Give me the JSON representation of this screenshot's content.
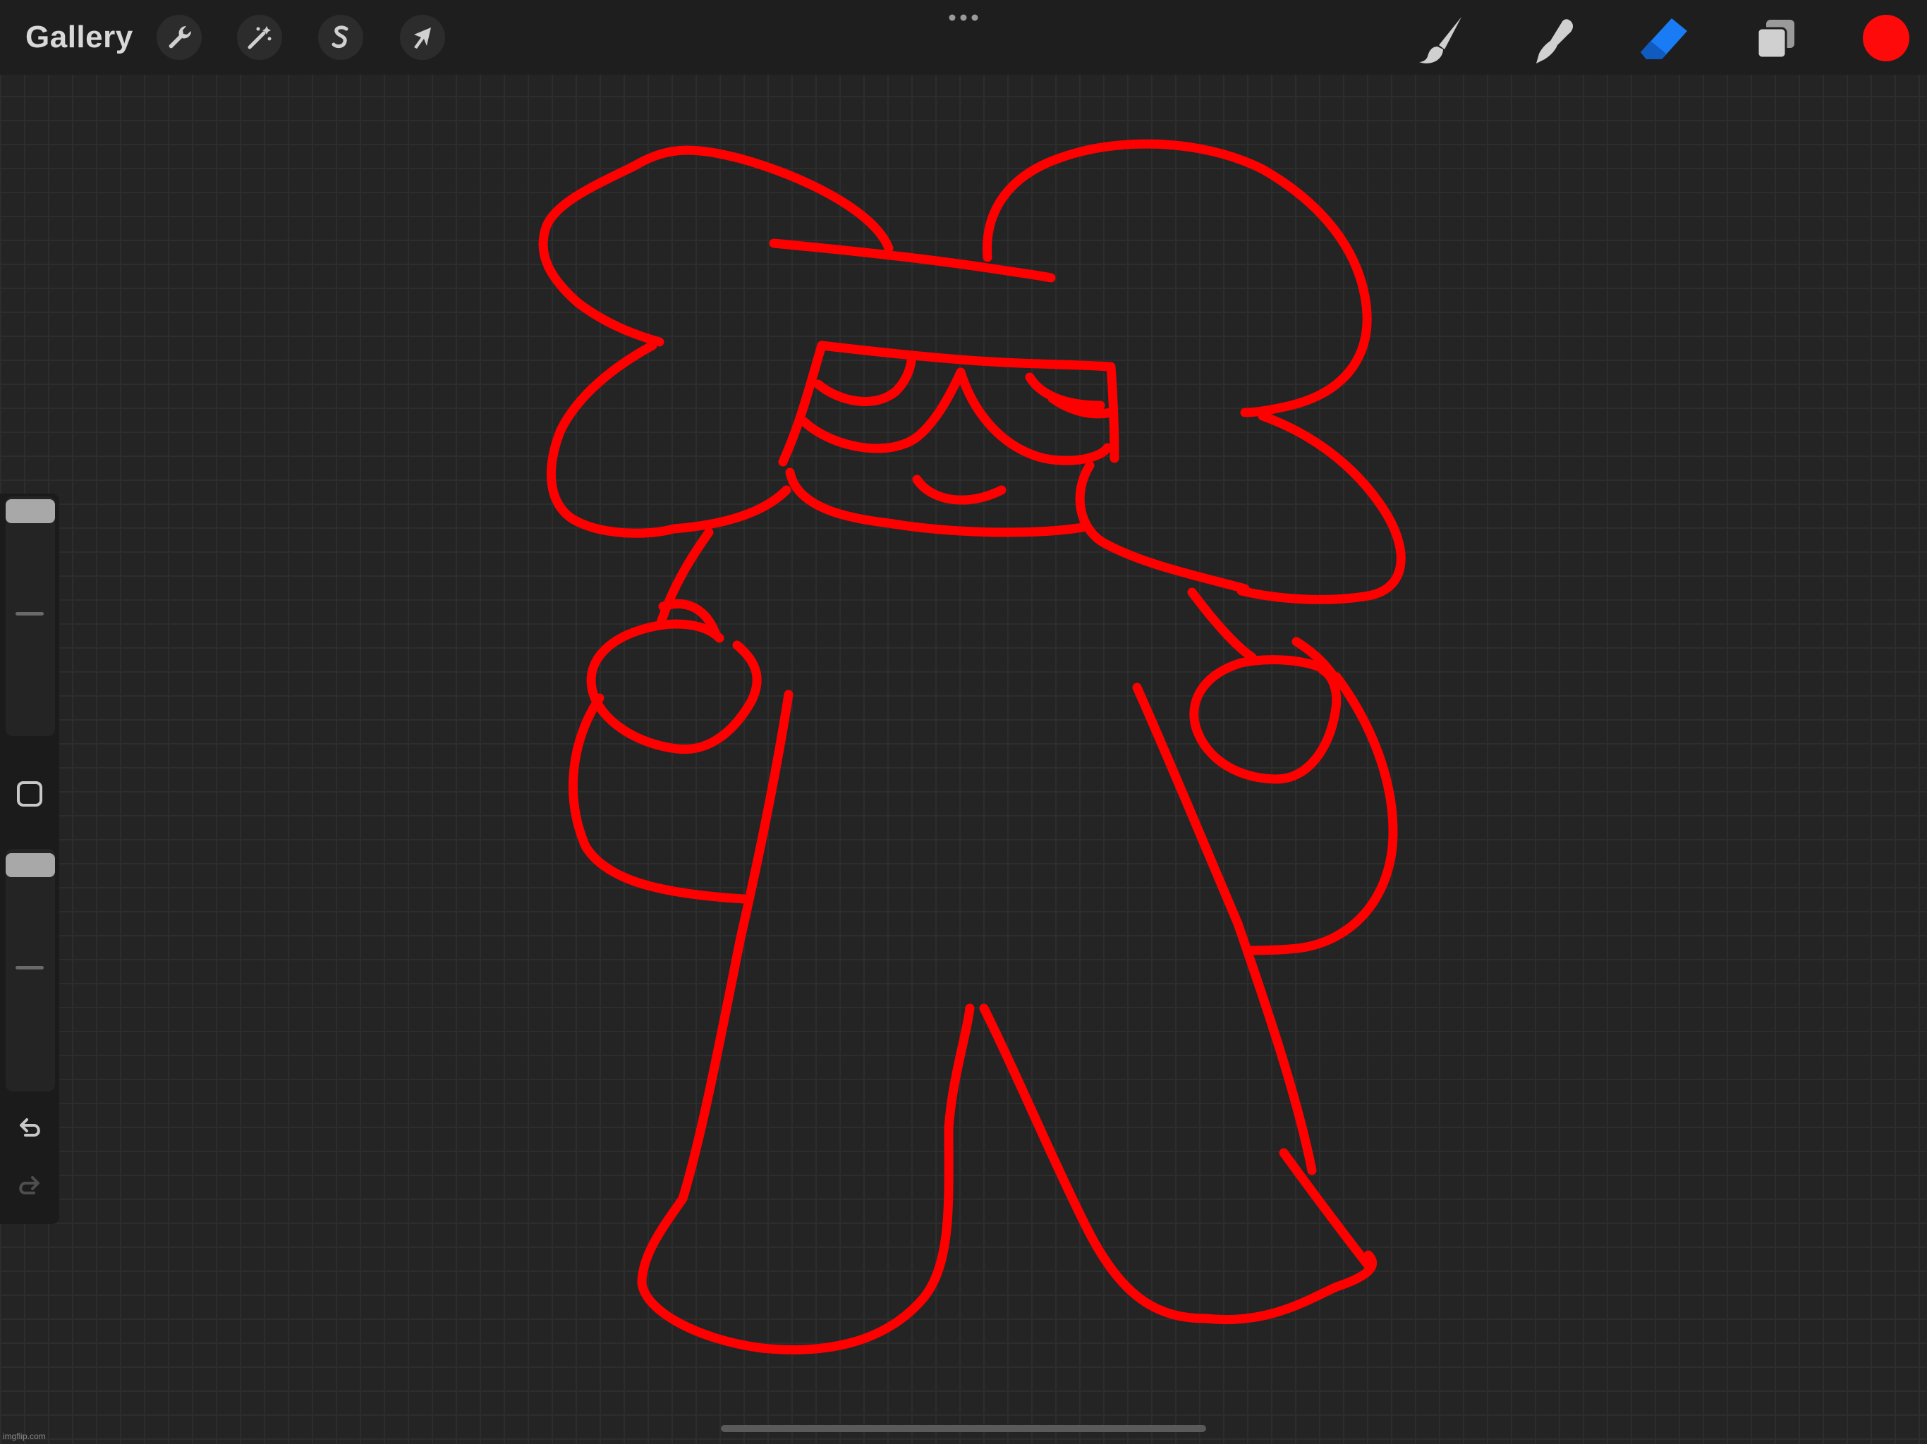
{
  "toolbar": {
    "gallery_label": "Gallery",
    "left_tools": [
      {
        "name": "actions",
        "icon": "wrench-icon"
      },
      {
        "name": "adjustments",
        "icon": "magic-wand-icon"
      },
      {
        "name": "selection",
        "icon": "selection-s-icon"
      },
      {
        "name": "transform",
        "icon": "arrow-cursor-icon"
      }
    ],
    "more_icon": "more-dots-icon",
    "right_tools": [
      {
        "name": "brush",
        "icon": "paintbrush-icon",
        "active": false
      },
      {
        "name": "smudge",
        "icon": "smudge-finger-icon",
        "active": false
      },
      {
        "name": "eraser",
        "icon": "eraser-icon",
        "active": true
      },
      {
        "name": "layers",
        "icon": "layers-icon",
        "active": false
      }
    ],
    "current_color": "#ff0a0a",
    "accent_color": "#1a7cf5"
  },
  "sidebar": {
    "brush_size_level": 0.95,
    "opacity_level": 0.95,
    "modify_icon": "square-icon",
    "undo_icon": "undo-arrow-icon",
    "redo_icon": "redo-arrow-icon"
  },
  "canvas": {
    "stroke_color": "#ff0000",
    "background_color": "#242424"
  },
  "watermark": "imgflip.com"
}
